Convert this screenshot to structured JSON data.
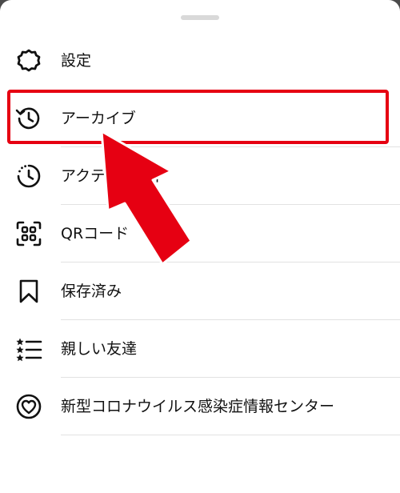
{
  "menu": {
    "items": [
      {
        "label": "設定",
        "icon": "gear-icon"
      },
      {
        "label": "アーカイブ",
        "icon": "archive-history-icon"
      },
      {
        "label": "アクティビティ",
        "icon": "activity-clock-icon"
      },
      {
        "label": "QRコード",
        "icon": "qr-code-icon"
      },
      {
        "label": "保存済み",
        "icon": "bookmark-icon"
      },
      {
        "label": "親しい友達",
        "icon": "close-friends-list-icon"
      },
      {
        "label": "新型コロナウイルス感染症情報センター",
        "icon": "heart-info-icon"
      }
    ]
  },
  "annotation": {
    "highlight_color": "#e60012",
    "highlighted_item": "アーカイブ"
  }
}
